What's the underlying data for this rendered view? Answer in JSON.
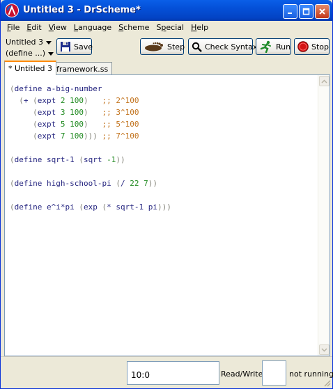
{
  "window": {
    "title": "Untitled 3 - DrScheme*"
  },
  "menu": [
    "File",
    "Edit",
    "View",
    "Language",
    "Scheme",
    "Special",
    "Help"
  ],
  "menu_underline": [
    "F",
    "E",
    "V",
    "L",
    "S",
    "p",
    "H"
  ],
  "toolbar": {
    "file_picker": "Untitled 3",
    "define_picker": "(define ...)",
    "save_label": "Save",
    "step_label": "Step",
    "check_syntax_label": "Check Syntax",
    "run_label": "Run",
    "stop_label": "Stop"
  },
  "tabs": [
    {
      "label": "* Untitled 3",
      "active": true
    },
    {
      "label": "framework.ss",
      "active": false
    }
  ],
  "code_lines": [
    [
      [
        "(",
        "c-paren"
      ],
      [
        "define a-big-number",
        "c-kw"
      ]
    ],
    [
      [
        "  ",
        ""
      ],
      [
        "(",
        "c-paren"
      ],
      [
        "+ ",
        "c-kw"
      ],
      [
        "(",
        "c-paren"
      ],
      [
        "expt ",
        "c-kw"
      ],
      [
        "2 100",
        "c-num"
      ],
      [
        ")",
        "c-paren"
      ],
      [
        "   ",
        ""
      ],
      [
        ";; 2^100",
        "c-cmt"
      ]
    ],
    [
      [
        "     ",
        ""
      ],
      [
        "(",
        "c-paren"
      ],
      [
        "expt ",
        "c-kw"
      ],
      [
        "3 100",
        "c-num"
      ],
      [
        ")",
        "c-paren"
      ],
      [
        "   ",
        ""
      ],
      [
        ";; 3^100",
        "c-cmt"
      ]
    ],
    [
      [
        "     ",
        ""
      ],
      [
        "(",
        "c-paren"
      ],
      [
        "expt ",
        "c-kw"
      ],
      [
        "5 100",
        "c-num"
      ],
      [
        ")",
        "c-paren"
      ],
      [
        "   ",
        ""
      ],
      [
        ";; 5^100",
        "c-cmt"
      ]
    ],
    [
      [
        "     ",
        ""
      ],
      [
        "(",
        "c-paren"
      ],
      [
        "expt ",
        "c-kw"
      ],
      [
        "7 100",
        "c-num"
      ],
      [
        ")))",
        "c-paren"
      ],
      [
        " ",
        ""
      ],
      [
        ";; 7^100",
        "c-cmt"
      ]
    ],
    [],
    [
      [
        "(",
        "c-paren"
      ],
      [
        "define sqrt-1 ",
        "c-kw"
      ],
      [
        "(",
        "c-paren"
      ],
      [
        "sqrt ",
        "c-kw"
      ],
      [
        "-1",
        "c-num"
      ],
      [
        "))",
        "c-paren"
      ]
    ],
    [],
    [
      [
        "(",
        "c-paren"
      ],
      [
        "define high-school-pi ",
        "c-kw"
      ],
      [
        "(",
        "c-paren"
      ],
      [
        "/ ",
        "c-kw"
      ],
      [
        "22 7",
        "c-num"
      ],
      [
        "))",
        "c-paren"
      ]
    ],
    [],
    [
      [
        "(",
        "c-paren"
      ],
      [
        "define e^i*pi ",
        "c-kw"
      ],
      [
        "(",
        "c-paren"
      ],
      [
        "exp ",
        "c-kw"
      ],
      [
        "(",
        "c-paren"
      ],
      [
        "* sqrt-1 pi",
        "c-kw"
      ],
      [
        ")))",
        "c-paren"
      ]
    ]
  ],
  "status": {
    "position": "10:0",
    "mode": "Read/Write",
    "running": "not running"
  },
  "colors": {
    "titlebar": "#0450d8",
    "code_keyword": "#262680",
    "code_number": "#228b22",
    "code_comment": "#c2741f",
    "code_paren": "#84847a",
    "tab_accent": "#ff8a00"
  }
}
